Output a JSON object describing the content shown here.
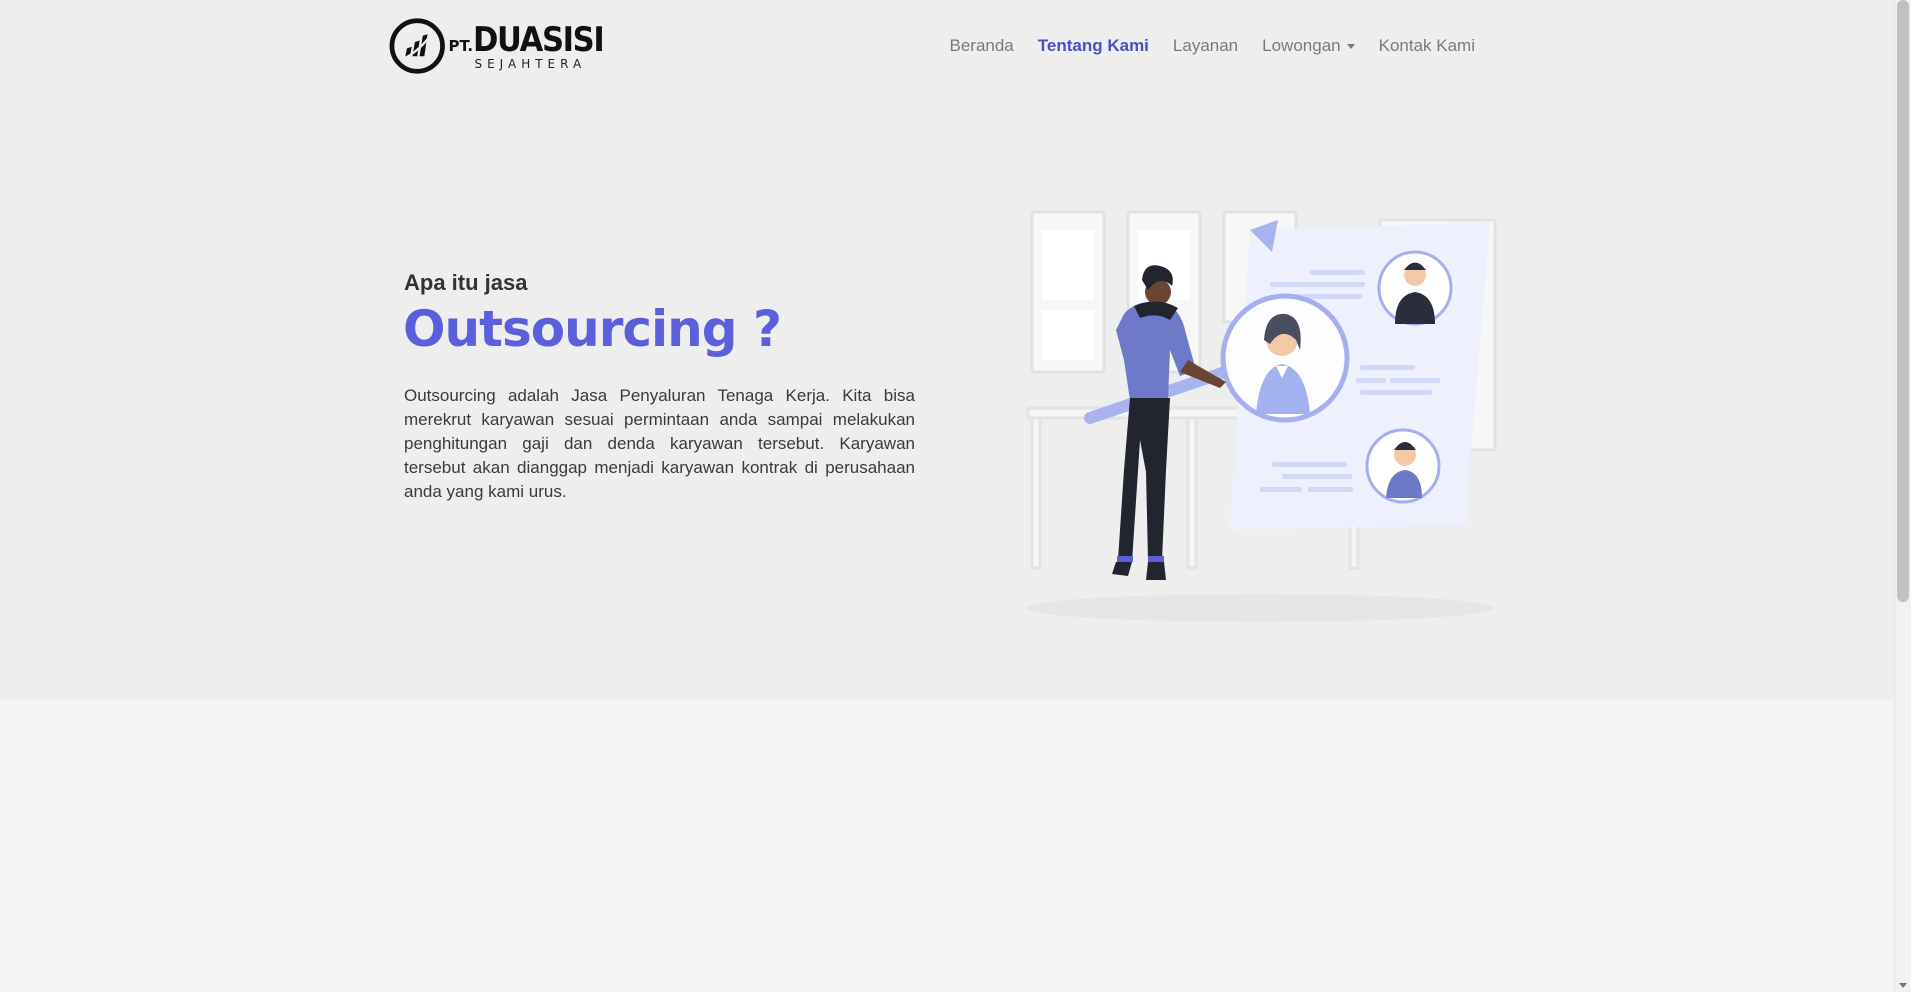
{
  "brand": {
    "prefix": "PT.",
    "name": "DUASISI",
    "tagline": "SEJAHTERA",
    "logo_icon": "chart-bars-circle-icon"
  },
  "nav": {
    "items": [
      {
        "label": "Beranda",
        "active": false
      },
      {
        "label": "Tentang Kami",
        "active": true
      },
      {
        "label": "Layanan",
        "active": false
      },
      {
        "label": "Lowongan",
        "active": false,
        "dropdown": true
      },
      {
        "label": "Kontak Kami",
        "active": false
      }
    ]
  },
  "hero": {
    "subtitle": "Apa itu jasa",
    "title": "Outsourcing ?",
    "body": "Outsourcing adalah Jasa Penyaluran Tenaga Kerja. Kita bisa merekrut karyawan sesuai permintaan anda sampai melakukan penghitungan gaji dan denda karyawan tersebut. Karyawan tersebut akan dianggap menjadi karyawan kontrak di perusahaan anda yang kami urus."
  },
  "colors": {
    "accent": "#5b5fdb",
    "nav_active": "#4b4ec9",
    "nav_text": "#7a7a7a",
    "hero_bg": "#eeeeee",
    "page_bg": "#f4f4f4"
  }
}
